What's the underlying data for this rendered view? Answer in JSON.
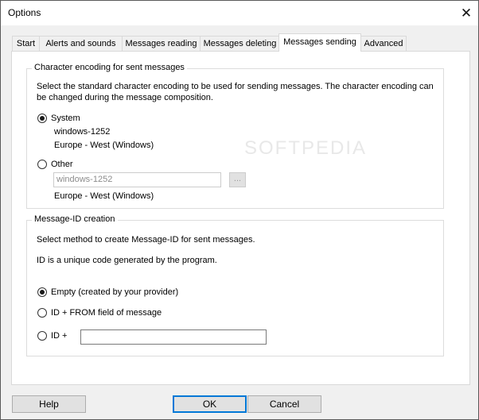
{
  "window": {
    "title": "Options"
  },
  "tabs": [
    {
      "label": "Start"
    },
    {
      "label": "Alerts and sounds"
    },
    {
      "label": "Messages reading"
    },
    {
      "label": "Messages deleting"
    },
    {
      "label": "Messages sending",
      "active": true
    },
    {
      "label": "Advanced"
    }
  ],
  "encoding_group": {
    "title": "Character encoding for sent messages",
    "description_line1": "Select the standard character encoding to be used for sending messages. The character encoding can",
    "description_line2": "be changed during the message composition.",
    "system": {
      "label": "System",
      "checked": true,
      "charset": "windows-1252",
      "charset_desc": "Europe - West (Windows)"
    },
    "other": {
      "label": "Other",
      "checked": false,
      "input_value": "windows-1252",
      "browse_label": "...",
      "charset_desc": "Europe - West (Windows)"
    }
  },
  "msgid_group": {
    "title": "Message-ID creation",
    "description_line1": "Select method to create Message-ID for sent messages.",
    "description_line2": "ID is a unique code generated by the program.",
    "options": [
      {
        "label": "Empty (created by your provider)",
        "checked": true
      },
      {
        "label": "ID + FROM field of message",
        "checked": false
      },
      {
        "label": "ID +",
        "checked": false
      }
    ],
    "id_plus_value": ""
  },
  "buttons": {
    "help": "Help",
    "ok": "OK",
    "cancel": "Cancel"
  },
  "watermark": "SOFTPEDIA",
  "colors": {
    "accent": "#0078d7",
    "panel_bg": "#ffffff",
    "window_bg": "#f0f0f0"
  }
}
